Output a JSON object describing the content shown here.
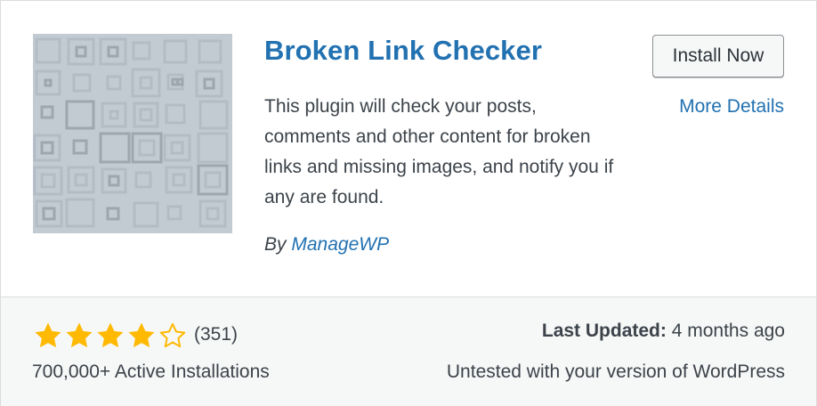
{
  "plugin": {
    "title": "Broken Link Checker",
    "description": "This plugin will check your posts, comments and other content for broken links and missing images, and notify you if any are found.",
    "author_prefix": "By",
    "author_name": "ManageWP",
    "thumbnail_icon": "plugin-pattern-icon"
  },
  "actions": {
    "install_label": "Install Now",
    "details_label": "More Details"
  },
  "stats": {
    "rating_value": 4,
    "rating_max": 5,
    "rating_count": "(351)",
    "installs": "700,000+ Active Installations",
    "last_updated_label": "Last Updated:",
    "last_updated_value": "4 months ago",
    "compatibility": "Untested with your version of WordPress"
  },
  "colors": {
    "link": "#2271b1",
    "star": "#ffb900",
    "text": "#3c434a",
    "footer_bg": "#f6f7f7"
  }
}
